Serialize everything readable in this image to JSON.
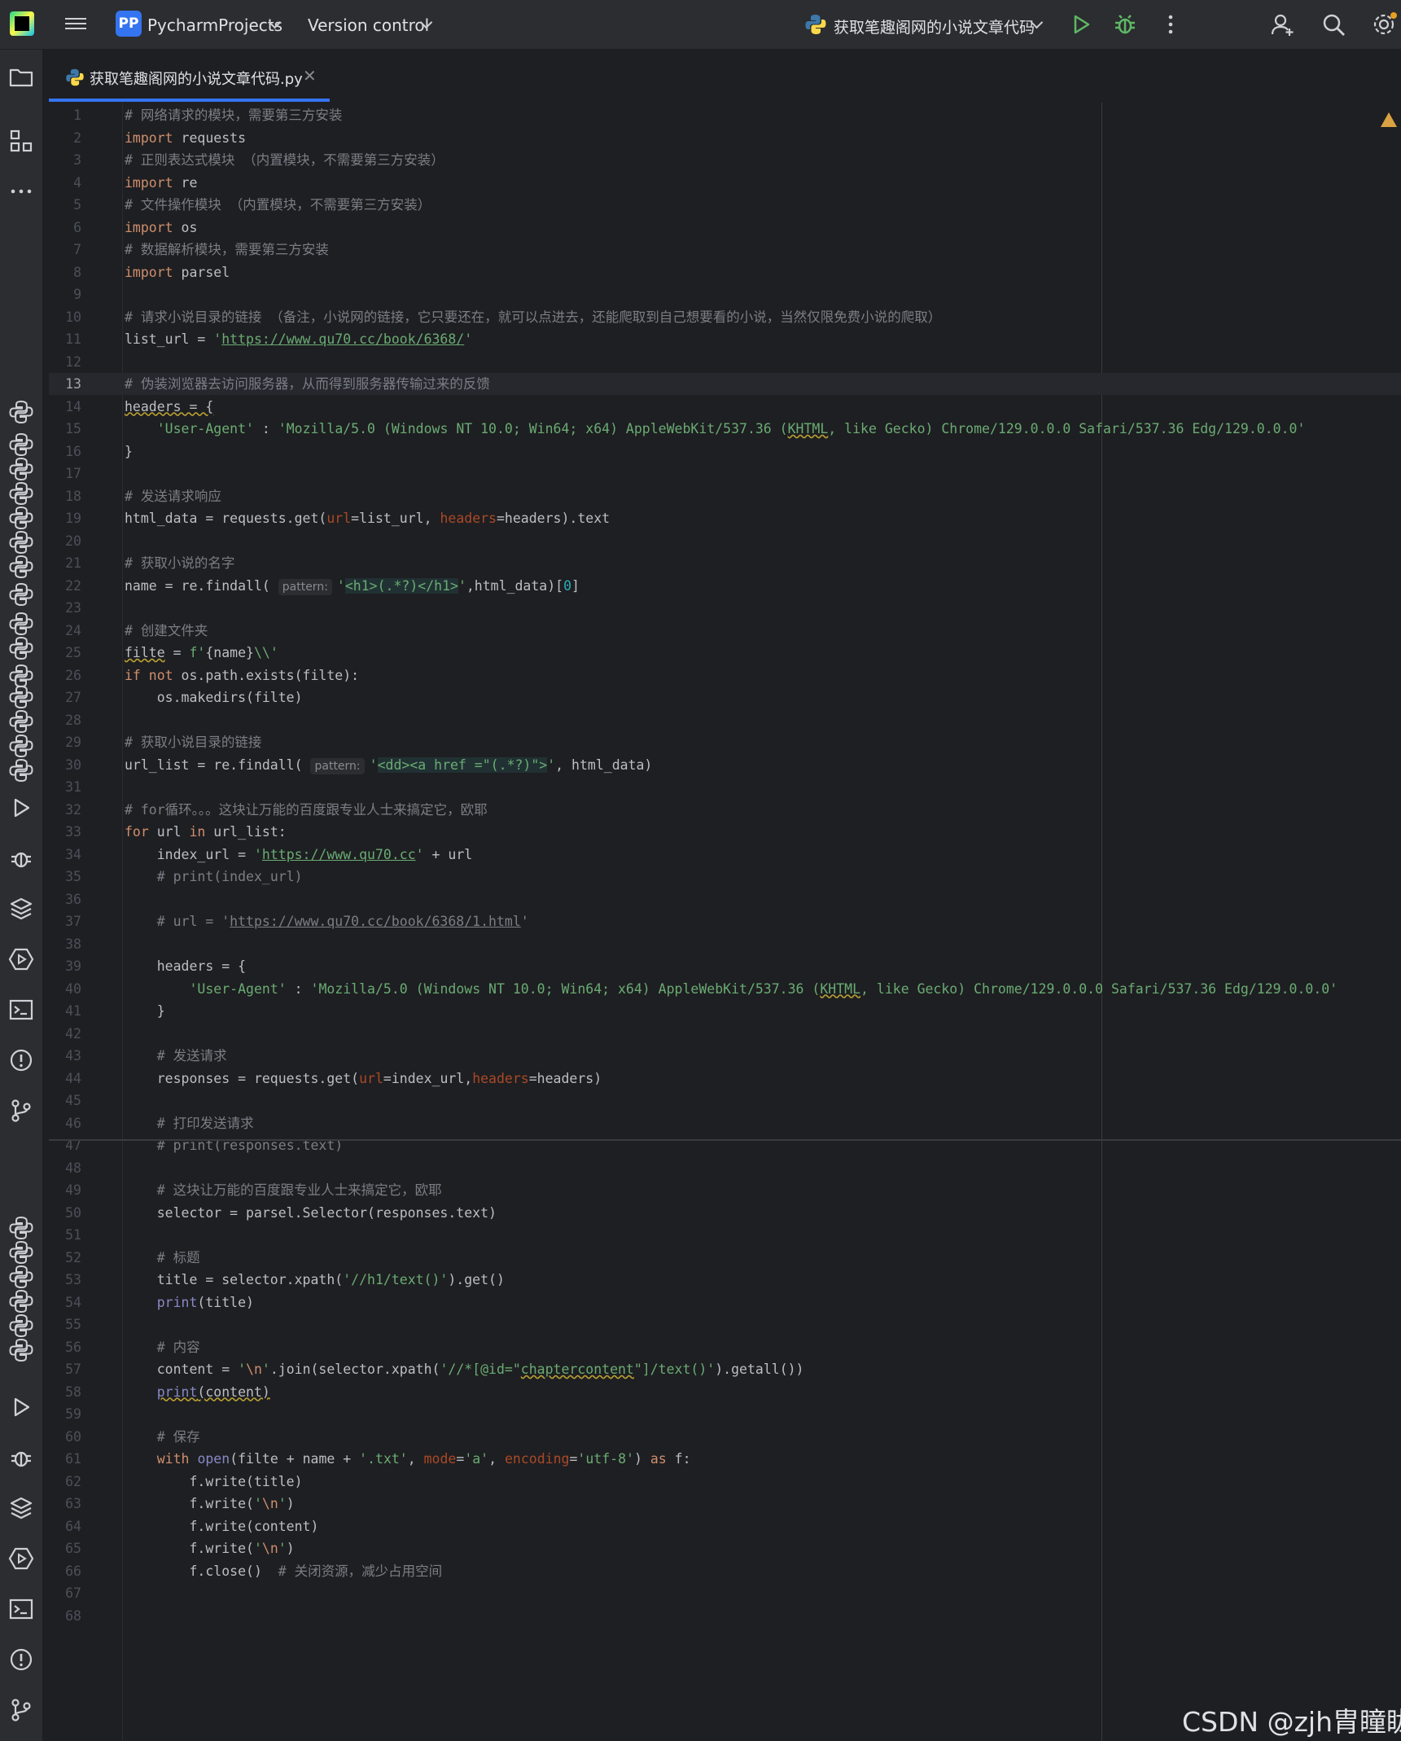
{
  "titlebar": {
    "project_badge": "PP",
    "project_name": "PycharmProjects",
    "version_control": "Version control",
    "run_config": "获取笔趣阁网的小说文章代码"
  },
  "tab": {
    "label": "获取笔趣阁网的小说文章代码.py",
    "close": "✕"
  },
  "colors": {
    "accent": "#3574f0",
    "run_green": "#5fb865",
    "keyword": "#cf8e6d",
    "string": "#6aab73",
    "comment": "#7a7e85"
  },
  "icons": [
    "project-folder-icon",
    "structure-icon",
    "more-icon",
    "python-console-icon",
    "run-icon",
    "debug-icon",
    "layers-icon",
    "services-icon",
    "terminal-icon",
    "problems-icon",
    "git-icon",
    "add-user-icon",
    "search-icon",
    "settings-icon",
    "warning-icon"
  ],
  "code_lines": [
    "<span class='cm'># 网络请求的模块，需要第三方安装</span>",
    "<span class='kw'>import</span> requests",
    "<span class='cm'># 正则表达式模块 （内置模块，不需要第三方安装）</span>",
    "<span class='kw'>import</span> re",
    "<span class='cm'># 文件操作模块 （内置模块，不需要第三方安装）</span>",
    "<span class='kw'>import</span> os",
    "<span class='cm'># 数据解析模块，需要第三方安装</span>",
    "<span class='kw'>import</span> parsel",
    "",
    "<span class='cm'># 请求小说目录的链接 （备注，小说网的链接，它只要还在，就可以点进去，还能爬取到自己想要看的小说，当然仅限免费小说的爬取）</span>",
    "list_url = <span class='str'>'<span class='ul'>https://www.qu70.cc/book/6368/</span>'</span>",
    "",
    "<span class='cm'># 伪装浏览器去访问服务器，从而得到服务器传输过来的反馈</span>",
    "<span class='wl'>headers = {</span>",
    "    <span class='str'>'User-Agent'</span> : <span class='str'>'Mozilla/5.0 (Windows NT 10.0; Win64; x64) AppleWebKit/537.36 (<span class='wl'>KHTML</span>, like Gecko) Chrome/129.0.0.0 Safari/537.36 Edg/129.0.0.0'</span>",
    "}",
    "",
    "<span class='cm'># 发送请求响应</span>",
    "html_data = requests.get(<span class='par'>url</span>=list_url, <span class='par'>headers</span>=headers).text",
    "",
    "<span class='cm'># 获取小说的名字</span>",
    "name = re.findall( <span class='hint'>pattern:</span><span class='str'>'<span class='rx'>&lt;h1&gt;(.*?)&lt;/h1&gt;</span>'</span>,html_data)[<span class='num'>0</span>]",
    "",
    "<span class='cm'># 创建文件夹</span>",
    "<span class='wl'>filte</span> = <span class='str'>f'</span>{name}<span class='str'>\\\\'</span>",
    "<span class='kw'>if not</span> os.path.exists(filte):",
    "    os.makedirs(filte)",
    "",
    "<span class='cm'># 获取小说目录的链接</span>",
    "url_list = re.findall( <span class='hint'>pattern:</span><span class='str'>'<span class='rx'>&lt;dd&gt;&lt;a href =\"(.*?)\"&gt;</span>'</span>, html_data)",
    "",
    "<span class='cm'># for循环。。。这块让万能的百度跟专业人士来搞定它，欧耶</span>",
    "<span class='kw'>for</span> url <span class='kw'>in</span> url_list:",
    "    index_url = <span class='str'>'<span class='ul'>https://www.qu70.cc</span>'</span> + url",
    "    <span class='cm'># print(index_url)</span>",
    "",
    "    <span class='cm'># url = '<span style='text-decoration:underline'>https://www.qu70.cc/book/6368/1.html</span>'</span>",
    "",
    "    headers = {",
    "        <span class='str'>'User-Agent'</span> : <span class='str'>'Mozilla/5.0 (Windows NT 10.0; Win64; x64) AppleWebKit/537.36 (<span class='wl'>KHTML</span>, like Gecko) Chrome/129.0.0.0 Safari/537.36 Edg/129.0.0.0'</span>",
    "    }",
    "",
    "    <span class='cm'># 发送请求</span>",
    "    responses = requests.get(<span class='par'>url</span>=index_url,<span class='par'>headers</span>=headers)",
    "",
    "    <span class='cm'># 打印发送请求</span>",
    "    <span class='cm'># print(responses.text)</span>",
    "",
    "    <span class='cm'># 这块让万能的百度跟专业人士来搞定它，欧耶</span>",
    "    selector = parsel.Selector(responses.text)",
    "",
    "    <span class='cm'># 标题</span>",
    "    title = selector.xpath(<span class='str'>'//h1/text()'</span>).get()",
    "    <span class='bi'>print</span>(title)",
    "",
    "    <span class='cm'># 内容</span>",
    "    content = <span class='str'>'</span><span class='kw'>\\n</span><span class='str'>'</span>.join(selector.xpath(<span class='str'>'//*[@id=\"<span class='wl'>chaptercontent</span>\"]/text()'</span>).getall())",
    "    <span class='wl'><span class='bi'>print</span>(content)</span>",
    "",
    "    <span class='cm'># 保存</span>",
    "    <span class='kw'>with</span> <span class='bi'>open</span>(filte + name + <span class='str'>'.txt'</span>, <span class='par'>mode</span>=<span class='str'>'a'</span>, <span class='par'>encoding</span>=<span class='str'>'utf-8'</span>) <span class='kw'>as</span> f:",
    "        f.write(title)",
    "        f.write(<span class='str'>'</span><span class='kw'>\\n</span><span class='str'>'</span>)",
    "        f.write(content)",
    "        f.write(<span class='str'>'</span><span class='kw'>\\n</span><span class='str'>'</span>)",
    "        f.close()  <span class='cm'># 关闭资源，减少占用空间</span>",
    "",
    ""
  ],
  "current_line": 13,
  "watermark": "CSDN @zjh胄瞳眬"
}
